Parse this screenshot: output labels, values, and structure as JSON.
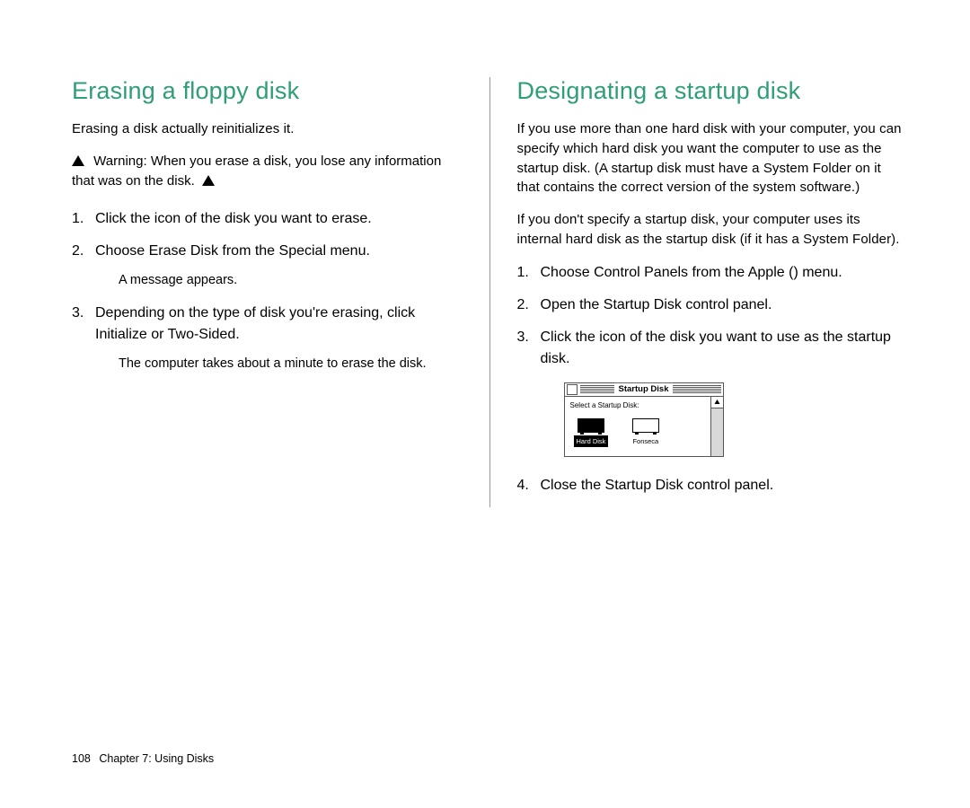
{
  "left": {
    "title": "Erasing a floppy disk",
    "intro": "Erasing a disk actually reinitializes it.",
    "warning_label": "Warning:",
    "warning_text": "When you erase a disk, you lose any information that was on the disk.",
    "steps": {
      "s1": "Click the icon of the disk you want to erase.",
      "s2": "Choose Erase Disk from the Special menu.",
      "s2_note": "A message appears.",
      "s3": "Depending on the type of disk you're erasing, click Initialize or Two-Sided.",
      "s3_note": "The computer takes about a minute to erase the disk."
    }
  },
  "right": {
    "title": "Designating a startup disk",
    "p1": "If you use more than one hard disk with your computer, you can specify which hard disk you want the computer to use as the startup disk. (A startup disk must have a System Folder on it that contains the correct version of the system software.)",
    "p2": "If you don't specify a startup disk, your computer uses its internal hard disk as the startup disk (if it has a System Folder).",
    "steps": {
      "s1_a": "Choose Control Panels from the Apple (",
      "s1_b": ") menu.",
      "s2": "Open the Startup Disk control panel.",
      "s3": "Click the icon of the disk you want to use as the startup disk.",
      "s4": "Close the Startup Disk control panel."
    },
    "panel": {
      "title": "Startup Disk",
      "prompt": "Select a Startup Disk:",
      "disk1": "Hard Disk",
      "disk2": "Fonseca"
    }
  },
  "footer": {
    "page": "108",
    "chapter": "Chapter 7: Using Disks"
  }
}
